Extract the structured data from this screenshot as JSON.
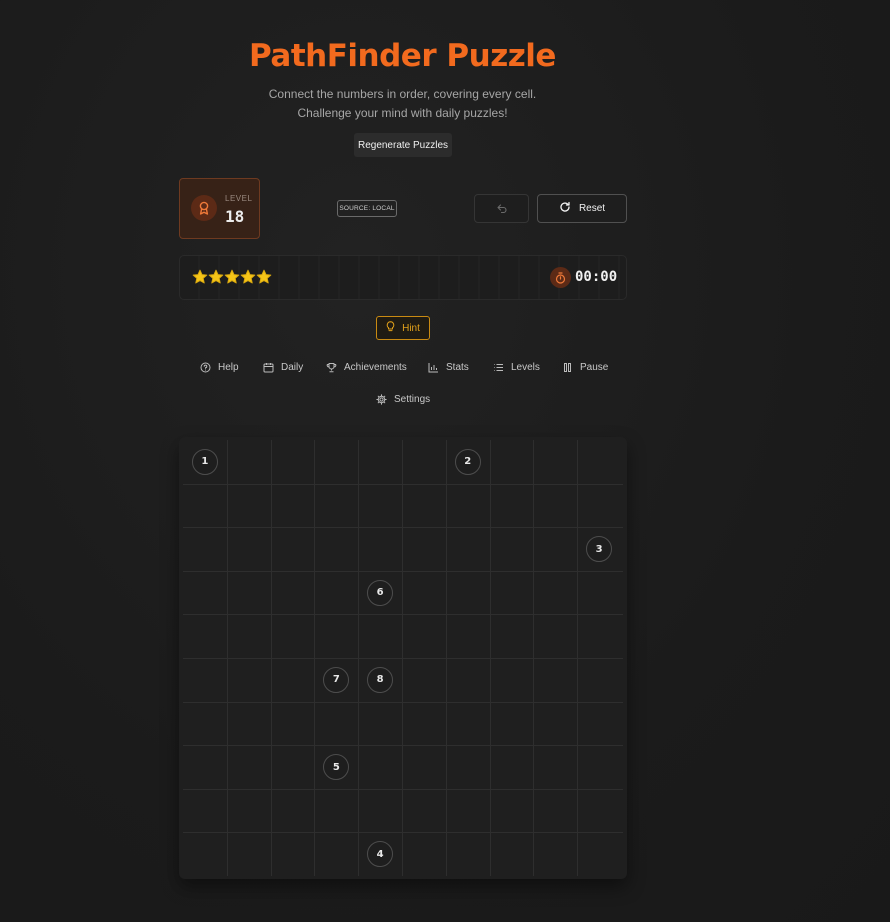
{
  "header": {
    "title": "PathFinder Puzzle",
    "subtitle_line1": "Connect the numbers in order, covering every cell.",
    "subtitle_line2": "Challenge your mind with daily puzzles!",
    "regenerate_label": "Regenerate Puzzles"
  },
  "level": {
    "label": "LEVEL",
    "value": "18",
    "icon": "medal-icon"
  },
  "source_badge": "SOURCE: LOCAL",
  "controls": {
    "undo_icon": "undo-icon",
    "reset_label": "Reset",
    "reset_icon": "refresh-icon"
  },
  "status": {
    "stars_filled": 5,
    "stars_total": 5,
    "timer": "00:00",
    "timer_icon": "stopwatch-icon"
  },
  "hint_label": "Hint",
  "nav": {
    "help": "Help",
    "daily": "Daily",
    "achievements": "Achievements",
    "stats": "Stats",
    "levels": "Levels",
    "pause": "Pause",
    "settings": "Settings"
  },
  "board": {
    "rows": 10,
    "cols": 10,
    "numbers": [
      {
        "value": "1",
        "row": 0,
        "col": 0
      },
      {
        "value": "2",
        "row": 0,
        "col": 6
      },
      {
        "value": "3",
        "row": 2,
        "col": 9
      },
      {
        "value": "6",
        "row": 3,
        "col": 4
      },
      {
        "value": "7",
        "row": 5,
        "col": 3
      },
      {
        "value": "8",
        "row": 5,
        "col": 4
      },
      {
        "value": "5",
        "row": 7,
        "col": 3
      },
      {
        "value": "4",
        "row": 9,
        "col": 4
      }
    ]
  },
  "colors": {
    "accent": "#f26a1e",
    "hint": "#e3a21a",
    "star": "#f5c518",
    "background": "#1b1b1b"
  }
}
